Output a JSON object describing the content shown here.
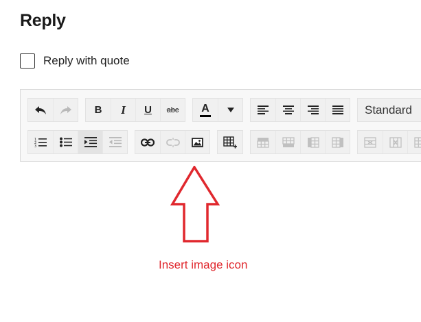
{
  "reply": {
    "title": "Reply",
    "quote_label": "Reply with quote"
  },
  "toolbar": {
    "bold": "B",
    "italic": "I",
    "underline": "U",
    "strikethrough": "abc",
    "font_color_letter": "A",
    "font_color": "#000000",
    "format_select": "Standard"
  },
  "annotation": {
    "text": "Insert image icon",
    "color": "#e0282e"
  },
  "colors": {
    "arrow": "#e0282e",
    "toolbar_bg": "#f0f0f0",
    "editor_bg": "#f8f8f8"
  }
}
